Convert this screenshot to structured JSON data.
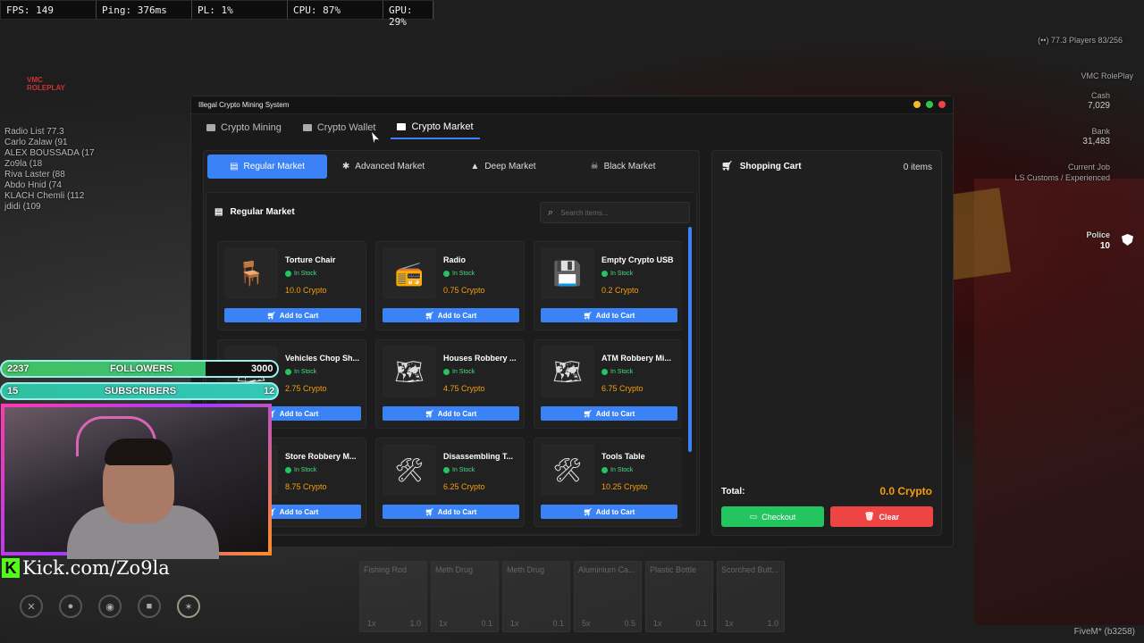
{
  "perf": [
    "FPS: 149",
    "Ping: 376ms",
    "PL: 1%",
    "CPU: 87%",
    "GPU: 29%"
  ],
  "hud": {
    "players": "(••) 77.3  Players 83/256",
    "server": "VMC RolePlay",
    "cash_label": "Cash",
    "cash_value": "7,029",
    "bank_label": "Bank",
    "bank_value": "31,483",
    "job_label": "Current Job",
    "job_value": "LS Customs / Experienced",
    "police_label": "Police",
    "police_value": "10"
  },
  "radio": [
    "Radio List 77.3",
    "Carlo Zalaw (91",
    "ALEX BOUSSADA (17",
    "Zo9la (18",
    "Riva Laster (88",
    "Abdo Hnid (74",
    "KLACH Chemli (112",
    "jdidi (109"
  ],
  "window": {
    "title": "Illegal Crypto Mining System",
    "tabs": [
      {
        "label": "Crypto Mining",
        "active": false
      },
      {
        "label": "Crypto Wallet",
        "active": false
      },
      {
        "label": "Crypto Market",
        "active": true
      }
    ]
  },
  "market_tabs": [
    {
      "label": "Regular Market",
      "icon": "store-icon",
      "active": true
    },
    {
      "label": "Advanced Market",
      "icon": "gear-icon",
      "active": false
    },
    {
      "label": "Deep Market",
      "icon": "warning-icon",
      "active": false
    },
    {
      "label": "Black Market",
      "icon": "skull-icon",
      "active": false
    }
  ],
  "market": {
    "heading": "Regular Market",
    "search_placeholder": "Search items...",
    "add_label": "Add to Cart",
    "items": [
      {
        "name": "Torture Chair",
        "stock": "In Stock",
        "price": "10.0 Crypto"
      },
      {
        "name": "Radio",
        "stock": "In Stock",
        "price": "0.75 Crypto"
      },
      {
        "name": "Empty Crypto USB",
        "stock": "In Stock",
        "price": "0.2 Crypto"
      },
      {
        "name": "Vehicles Chop Sh...",
        "stock": "In Stock",
        "price": "2.75 Crypto"
      },
      {
        "name": "Houses Robbery ...",
        "stock": "In Stock",
        "price": "4.75 Crypto"
      },
      {
        "name": "ATM Robbery Mi...",
        "stock": "In Stock",
        "price": "6.75 Crypto"
      },
      {
        "name": "Store Robbery M...",
        "stock": "In Stock",
        "price": "8.75 Crypto"
      },
      {
        "name": "Disassembling T...",
        "stock": "In Stock",
        "price": "6.25 Crypto"
      },
      {
        "name": "Tools Table",
        "stock": "In Stock",
        "price": "10.25 Crypto"
      }
    ]
  },
  "cart": {
    "title": "Shopping Cart",
    "count": "0 items",
    "total_label": "Total:",
    "total_value": "0.0 Crypto",
    "checkout_label": "Checkout",
    "clear_label": "Clear"
  },
  "overlay": {
    "followers_count": "2237",
    "followers_label": "FOLLOWERS",
    "followers_goal": "3000",
    "subs_count": "15",
    "subs_label": "SUBSCRIBERS",
    "subs_goal": "12",
    "kick": "Kick.com/Zo9la"
  },
  "inventory": [
    {
      "name": "Fishing Rod",
      "qty": "1x",
      "w": "1.0"
    },
    {
      "name": "Meth Drug",
      "qty": "1x",
      "w": "0.1"
    },
    {
      "name": "Meth Drug",
      "qty": "1x",
      "w": "0.1"
    },
    {
      "name": "Aluminium Ca...",
      "qty": "5x",
      "w": "0.5"
    },
    {
      "name": "Plastic Bottle",
      "qty": "1x",
      "w": "0.1"
    },
    {
      "name": "Scorched Butt...",
      "qty": "1x",
      "w": "1.0"
    }
  ],
  "build": "FiveM* (b3258)"
}
